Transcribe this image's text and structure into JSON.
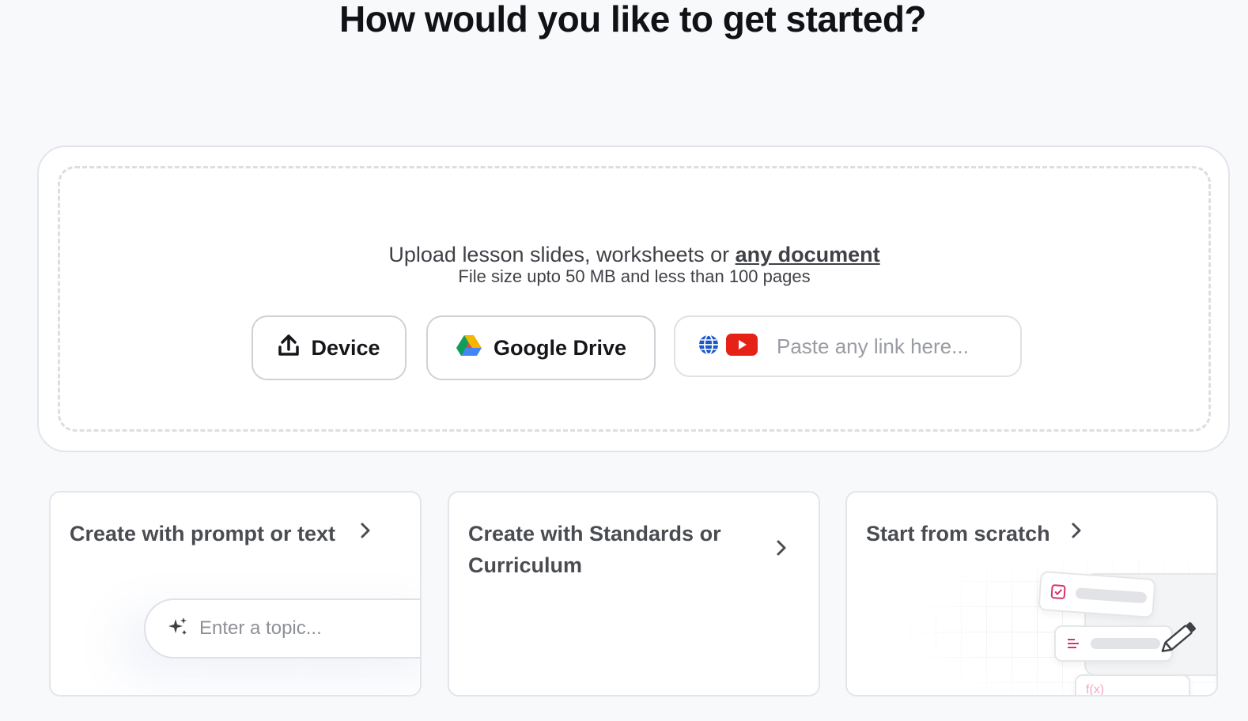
{
  "title": "How would you like to get started?",
  "upload": {
    "text_before": "Upload lesson slides, worksheets or ",
    "link_text": "any document",
    "limits": "File size upto 50 MB and less than 100 pages",
    "device_label": "Device",
    "drive_label": "Google Drive",
    "link_placeholder": "Paste any link here..."
  },
  "cards": {
    "prompt": {
      "title": "Create with prompt or text",
      "input_placeholder": "Enter a topic..."
    },
    "standards": {
      "title": "Create with Standards or Curriculum"
    },
    "scratch": {
      "title": "Start from scratch"
    }
  },
  "icons": {
    "device": "upload-icon",
    "drive": "google-drive-icon",
    "globe": "globe-icon",
    "youtube": "youtube-icon",
    "sparkle": "sparkle-icon",
    "chevron": "chevron-right-icon",
    "pencil": "pencil-icon"
  },
  "colors": {
    "background": "#f8f9fb",
    "youtube_red": "#e62117",
    "globe_blue": "#1a57c7",
    "accent_pink": "#d6336c"
  }
}
